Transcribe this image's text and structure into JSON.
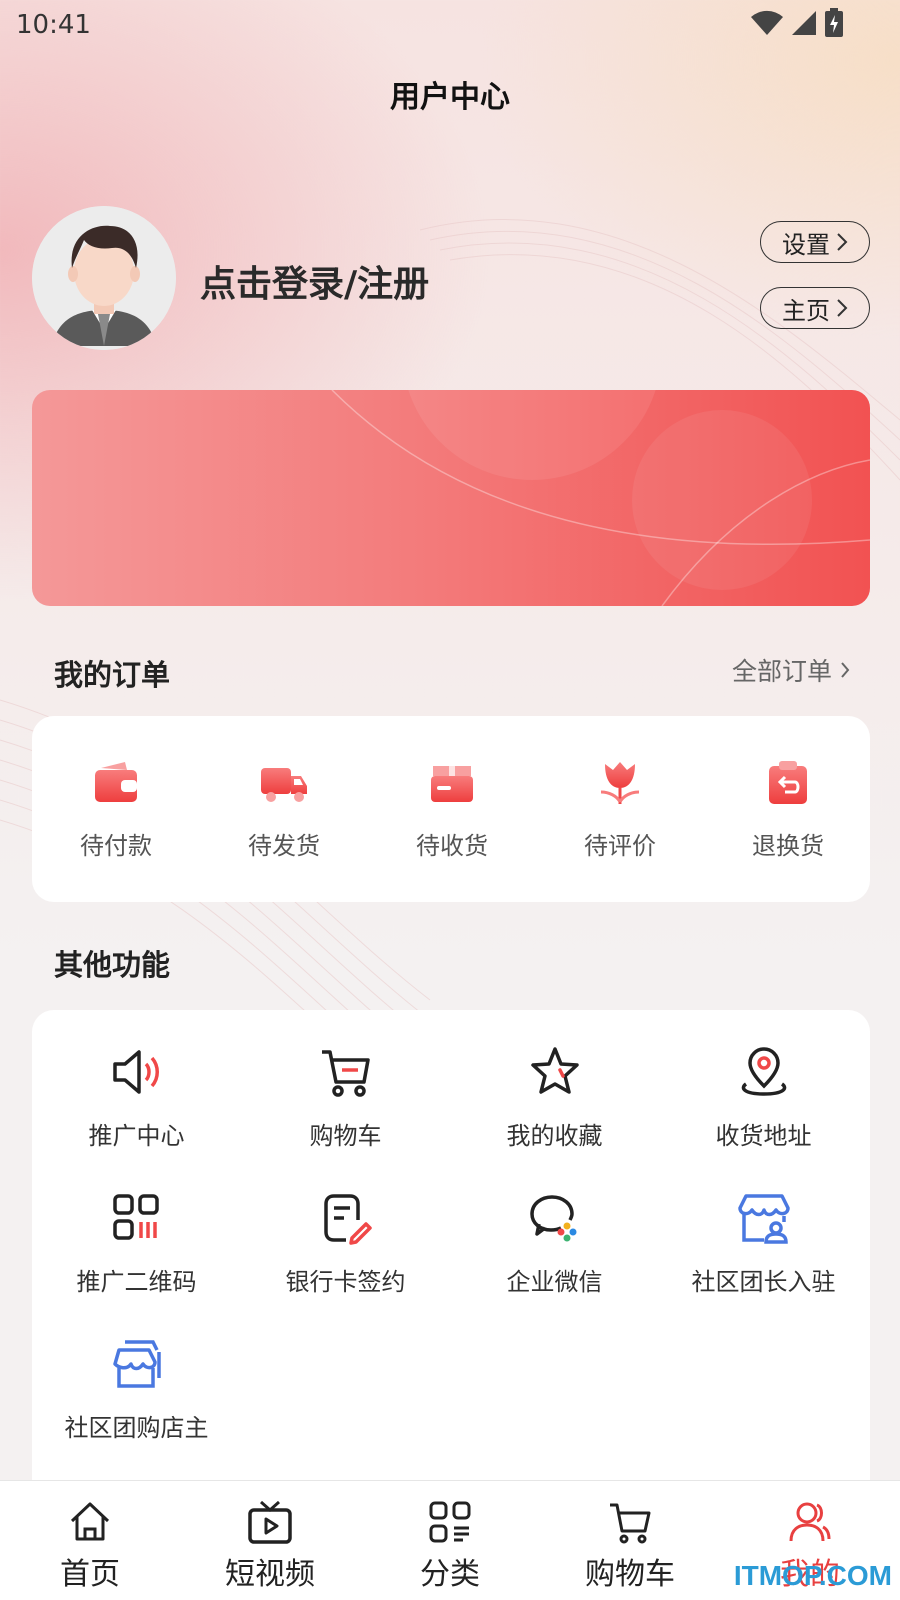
{
  "status_bar": {
    "time": "10:41"
  },
  "header": {
    "title": "用户中心"
  },
  "profile": {
    "login_text": "点击登录/注册",
    "settings_label": "设置",
    "home_label": "主页"
  },
  "orders": {
    "title": "我的订单",
    "all_label": "全部订单",
    "items": [
      {
        "label": "待付款",
        "icon": "wallet-icon"
      },
      {
        "label": "待发货",
        "icon": "truck-icon"
      },
      {
        "label": "待收货",
        "icon": "box-icon"
      },
      {
        "label": "待评价",
        "icon": "flower-icon"
      },
      {
        "label": "退换货",
        "icon": "return-icon"
      }
    ]
  },
  "functions": {
    "title": "其他功能",
    "items": [
      {
        "label": "推广中心",
        "icon": "megaphone-icon"
      },
      {
        "label": "购物车",
        "icon": "cart-icon"
      },
      {
        "label": "我的收藏",
        "icon": "star-icon"
      },
      {
        "label": "收货地址",
        "icon": "location-icon"
      },
      {
        "label": "推广二维码",
        "icon": "qrcode-icon"
      },
      {
        "label": "银行卡签约",
        "icon": "sign-icon"
      },
      {
        "label": "企业微信",
        "icon": "wecom-icon"
      },
      {
        "label": "社区团长入驻",
        "icon": "store-person-icon"
      },
      {
        "label": "社区团购店主",
        "icon": "stores-icon"
      }
    ]
  },
  "tabbar": {
    "items": [
      {
        "label": "首页",
        "icon": "home-icon"
      },
      {
        "label": "短视频",
        "icon": "video-icon"
      },
      {
        "label": "分类",
        "icon": "category-icon"
      },
      {
        "label": "购物车",
        "icon": "cart-icon"
      },
      {
        "label": "我的",
        "icon": "user-icon"
      }
    ],
    "active_index": 4
  },
  "watermark": "ITMOP.COM",
  "colors": {
    "accent": "#e84040",
    "icon_red": "#f04848",
    "icon_blue": "#4a78e0",
    "text_dark": "#222222"
  }
}
